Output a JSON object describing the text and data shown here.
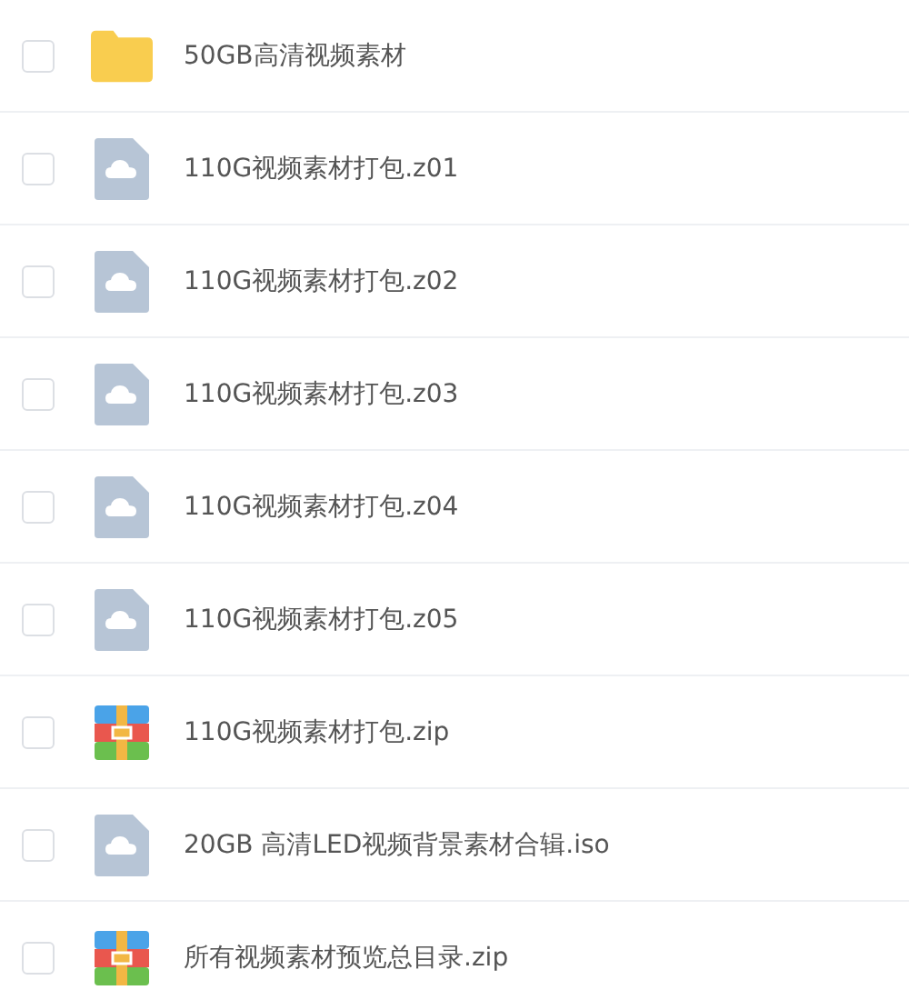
{
  "files": [
    {
      "kind": "folder",
      "name": "50GB高清视频素材",
      "checked": false
    },
    {
      "kind": "file",
      "name": "110G视频素材打包.z01",
      "checked": false
    },
    {
      "kind": "file",
      "name": "110G视频素材打包.z02",
      "checked": false
    },
    {
      "kind": "file",
      "name": "110G视频素材打包.z03",
      "checked": false
    },
    {
      "kind": "file",
      "name": "110G视频素材打包.z04",
      "checked": false
    },
    {
      "kind": "file",
      "name": "110G视频素材打包.z05",
      "checked": false
    },
    {
      "kind": "zip",
      "name": "110G视频素材打包.zip",
      "checked": false
    },
    {
      "kind": "file",
      "name": "20GB 高清LED视频背景素材合辑.iso",
      "checked": false
    },
    {
      "kind": "zip",
      "name": "所有视频素材预览总目录.zip",
      "checked": false
    }
  ]
}
